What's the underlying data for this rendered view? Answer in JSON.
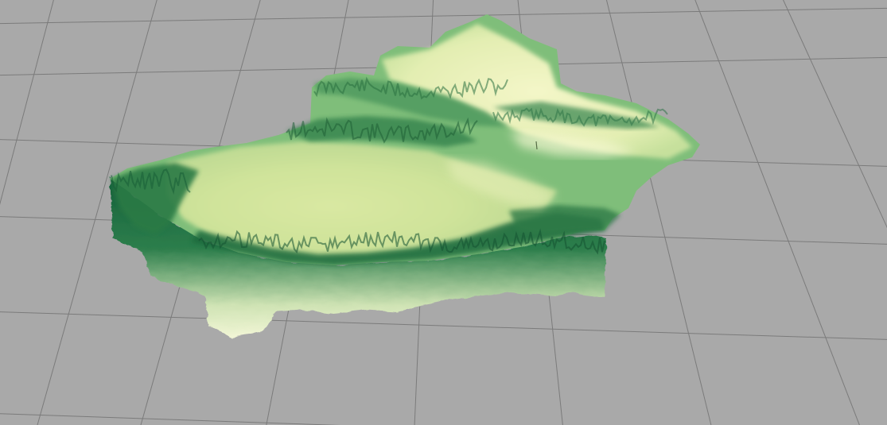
{
  "scene": {
    "type": "3d-terrain-relief",
    "background_color": "#a9a9a9",
    "ground_grid": true,
    "grid_line_color": "#7b7b7b",
    "elevation_color_ramp": [
      "#f7f8c6",
      "#dbeaa0",
      "#a8d18a",
      "#5fa86a",
      "#1f7040",
      "#0d4f2a"
    ],
    "wall_color_top": "#15603a",
    "wall_color_bottom": "#f2f6d6"
  }
}
